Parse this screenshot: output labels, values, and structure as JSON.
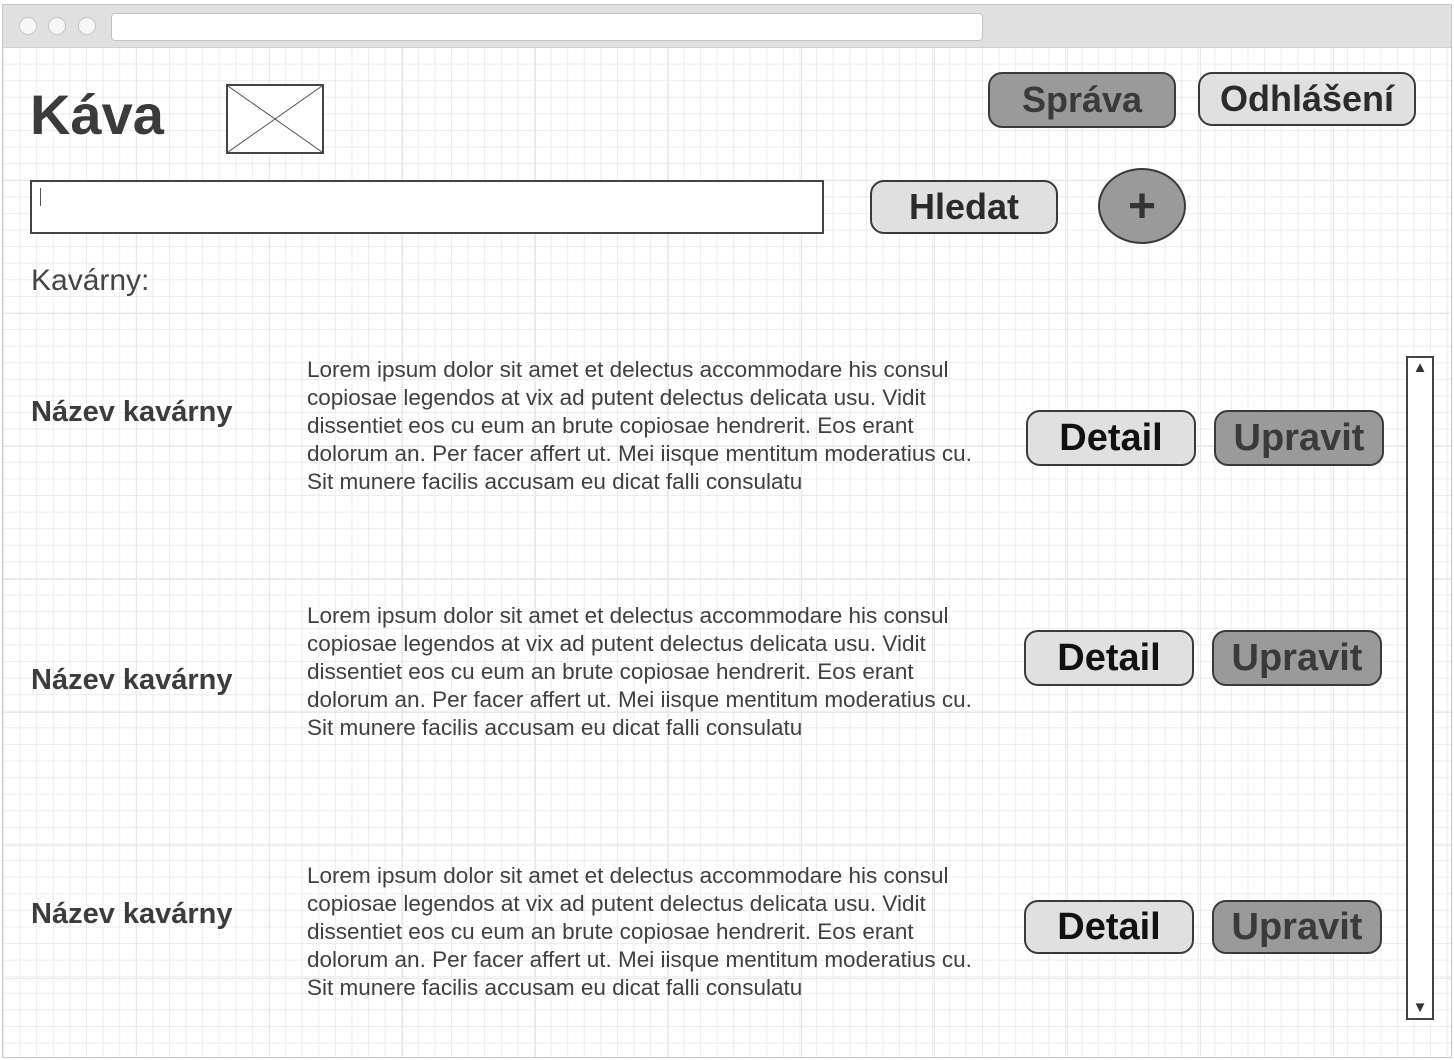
{
  "header": {
    "title": "Káva",
    "admin_label": "Správa",
    "logout_label": "Odhlášení"
  },
  "search": {
    "value": "",
    "placeholder": "",
    "button_label": "Hledat",
    "add_label": "+"
  },
  "list": {
    "label": "Kavárny:",
    "items": [
      {
        "name": "Název kavárny",
        "description": "Lorem ipsum dolor sit amet et delectus accommodare his consul copiosae legendos at vix ad putent delectus delicata usu. Vidit dissentiet eos cu eum an brute copiosae hendrerit. Eos erant dolorum an. Per facer affert ut. Mei iisque mentitum moderatius cu. Sit munere facilis accusam eu dicat falli consulatu",
        "detail_label": "Detail",
        "edit_label": "Upravit"
      },
      {
        "name": "Název kavárny",
        "description": "Lorem ipsum dolor sit amet et delectus accommodare his consul copiosae legendos at vix ad putent delectus delicata usu. Vidit dissentiet eos cu eum an brute copiosae hendrerit. Eos erant dolorum an. Per facer affert ut. Mei iisque mentitum moderatius cu. Sit munere facilis accusam eu dicat falli consulatu",
        "detail_label": "Detail",
        "edit_label": "Upravit"
      },
      {
        "name": "Název kavárny",
        "description": "Lorem ipsum dolor sit amet et delectus accommodare his consul copiosae legendos at vix ad putent delectus delicata usu. Vidit dissentiet eos cu eum an brute copiosae hendrerit. Eos erant dolorum an. Per facer affert ut. Mei iisque mentitum moderatius cu. Sit munere facilis accusam eu dicat falli consulatu",
        "detail_label": "Detail",
        "edit_label": "Upravit"
      }
    ]
  },
  "scrollbar": {
    "up_icon": "triangle-up-icon",
    "down_icon": "triangle-down-icon"
  }
}
